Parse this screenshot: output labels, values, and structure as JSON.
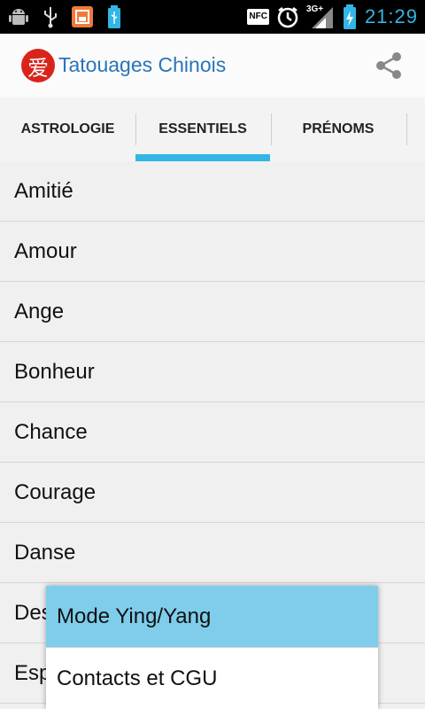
{
  "status_bar": {
    "time": "21:29",
    "nfc_label": "NFC",
    "network_label": "3G+",
    "icons_left": [
      "android-icon",
      "usb-icon",
      "notification-app-icon",
      "battery-usb-icon"
    ],
    "icons_right": [
      "nfc-icon",
      "alarm-icon",
      "signal-icon",
      "battery-charging-icon"
    ]
  },
  "app_bar": {
    "logo_glyph": "爱",
    "title": "Tatouages Chinois",
    "share_icon": "share-icon"
  },
  "tabs": [
    {
      "label": "ASTROLOGIE"
    },
    {
      "label": "ESSENTIELS",
      "selected": true
    },
    {
      "label": "PRÉNOMS"
    }
  ],
  "list": {
    "items": [
      {
        "label": "Amitié"
      },
      {
        "label": "Amour"
      },
      {
        "label": "Ange"
      },
      {
        "label": "Bonheur"
      },
      {
        "label": "Chance"
      },
      {
        "label": "Courage"
      },
      {
        "label": "Danse"
      },
      {
        "label": "Des"
      },
      {
        "label": "Esp"
      }
    ]
  },
  "popup_menu": {
    "items": [
      {
        "label": "Mode Ying/Yang",
        "selected": true
      },
      {
        "label": "Contacts et CGU"
      }
    ]
  },
  "colors": {
    "accent": "#33b5e5",
    "title_blue": "#2a74b8",
    "logo_red": "#d9241c",
    "menu_highlight": "#7fcdeb"
  }
}
